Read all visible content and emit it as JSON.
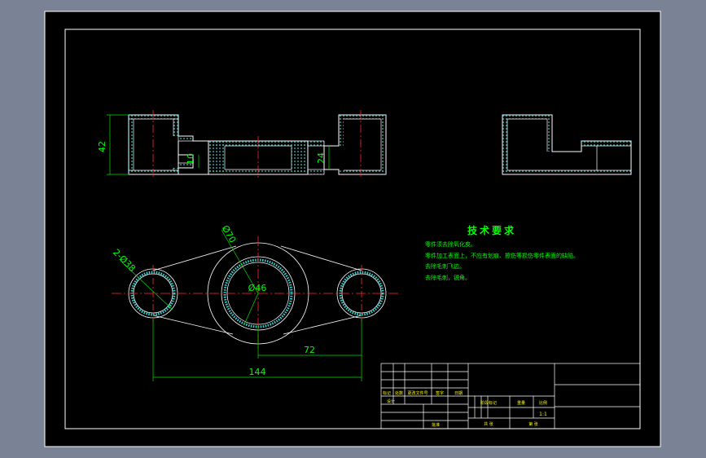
{
  "colors": {
    "viewport_bg": "#7a8395",
    "paper": "#000000",
    "border": "#ffffff",
    "outline": "#ffffff",
    "hatch": "#2fd3d3",
    "center": "#ff2b2b",
    "dim": "#00e000",
    "text": "#00ff00",
    "title_text": "#ffff00"
  },
  "dimensions": {
    "height_42": "42",
    "height_10": "10",
    "height_24": "24",
    "dia_70": "Ø70",
    "dia_46": "Ø46",
    "holes_2x38": "2-Ø38",
    "dist_72": "72",
    "dist_144": "144"
  },
  "tech_requirements": {
    "heading": "技术要求",
    "items": [
      "零件须去除氧化皮。",
      "零件加工表面上，不应有划痕、擦伤等损伤零件表面的缺陷。",
      "去除毛刺飞边。",
      "去除毛刺，锐角。"
    ]
  },
  "title_block": {
    "label_mark": "标记",
    "label_count": "处数",
    "label_change_doc": "更改文件号",
    "label_sign": "签字",
    "label_date": "日期",
    "label_designer": "设计",
    "label_stage": "阶段标记",
    "label_weight": "重量",
    "label_ratio": "比例",
    "ratio_value": "1:1",
    "label_total": "共 张",
    "label_sheet": "第 张",
    "label_approve": "批准"
  }
}
